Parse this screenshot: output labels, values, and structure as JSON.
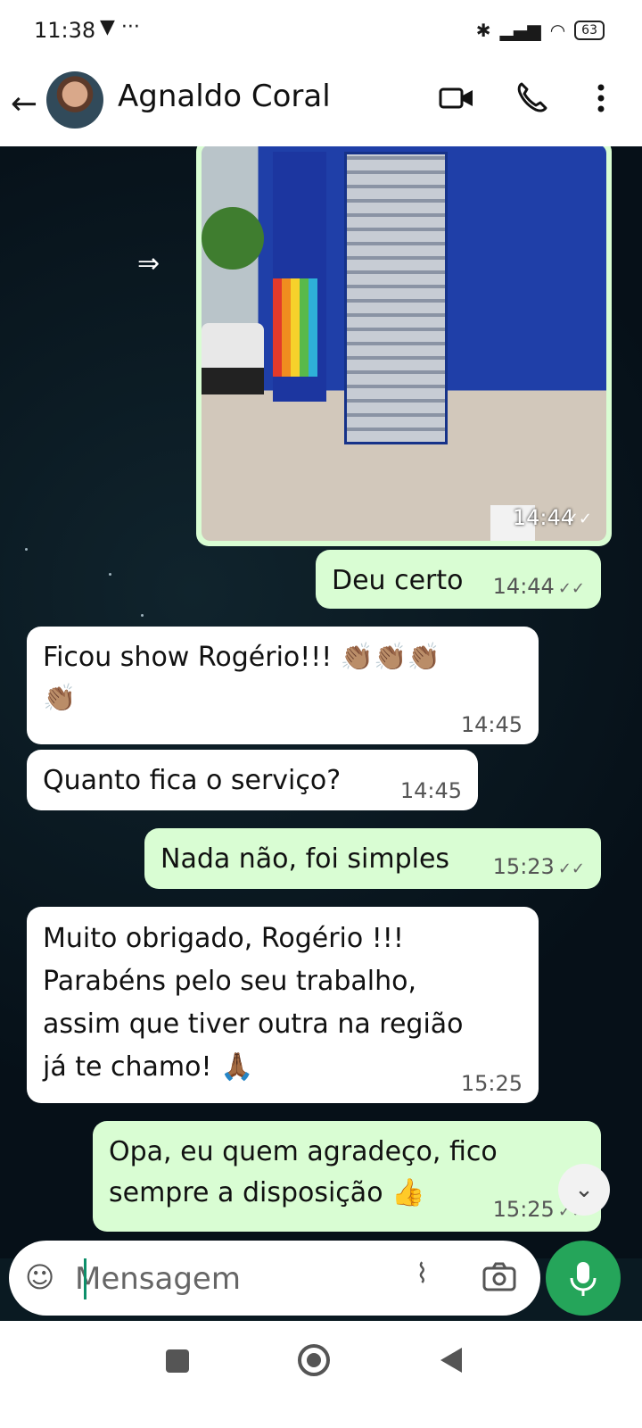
{
  "status_bar": {
    "time": "11:38",
    "left_icons": "▼ ···",
    "battery": "63"
  },
  "header": {
    "contact_name": "Agnaldo Coral"
  },
  "messages": [
    {
      "type": "image",
      "direction": "out",
      "time": "14:44",
      "status": "read"
    },
    {
      "type": "text",
      "direction": "out",
      "text": "Deu certo",
      "time": "14:44",
      "checks": "✓✓"
    },
    {
      "type": "text",
      "direction": "in",
      "line1": "Ficou show Rogério!!! 👏🏽👏🏽👏🏽",
      "line2": "👏🏽",
      "time": "14:45"
    },
    {
      "type": "text",
      "direction": "in",
      "text": "Quanto fica o serviço?",
      "time": "14:45"
    },
    {
      "type": "text",
      "direction": "out",
      "text": "Nada não, foi simples",
      "time": "15:23",
      "checks": "✓✓"
    },
    {
      "type": "text",
      "direction": "in",
      "line1": "Muito obrigado, Rogério !!!",
      "line2": "Parabéns pelo seu trabalho,",
      "line3": "assim que tiver outra na região",
      "line4": "já te chamo! 🙏🏾",
      "time": "15:25"
    },
    {
      "type": "text",
      "direction": "out",
      "line1": "Opa, eu quem agradeço, fico",
      "line2": "sempre a disposição 👍",
      "time": "15:25",
      "checks": "✓✓"
    }
  ],
  "composer": {
    "placeholder": "Mensagem"
  },
  "icons": {
    "back": "arrow-left-icon",
    "video": "video-call-icon",
    "call": "phone-icon",
    "more": "more-vert-icon",
    "emoji": "sticker-icon",
    "attach": "paperclip-icon",
    "camera": "camera-icon",
    "mic": "mic-icon",
    "forward": "forward-icon",
    "scroll": "chevron-double-down-icon"
  },
  "colors": {
    "outgoing_bubble": "#d9fdd3",
    "incoming_bubble": "#ffffff",
    "mic_button": "#25a55a",
    "caret": "#0d8f6a"
  }
}
